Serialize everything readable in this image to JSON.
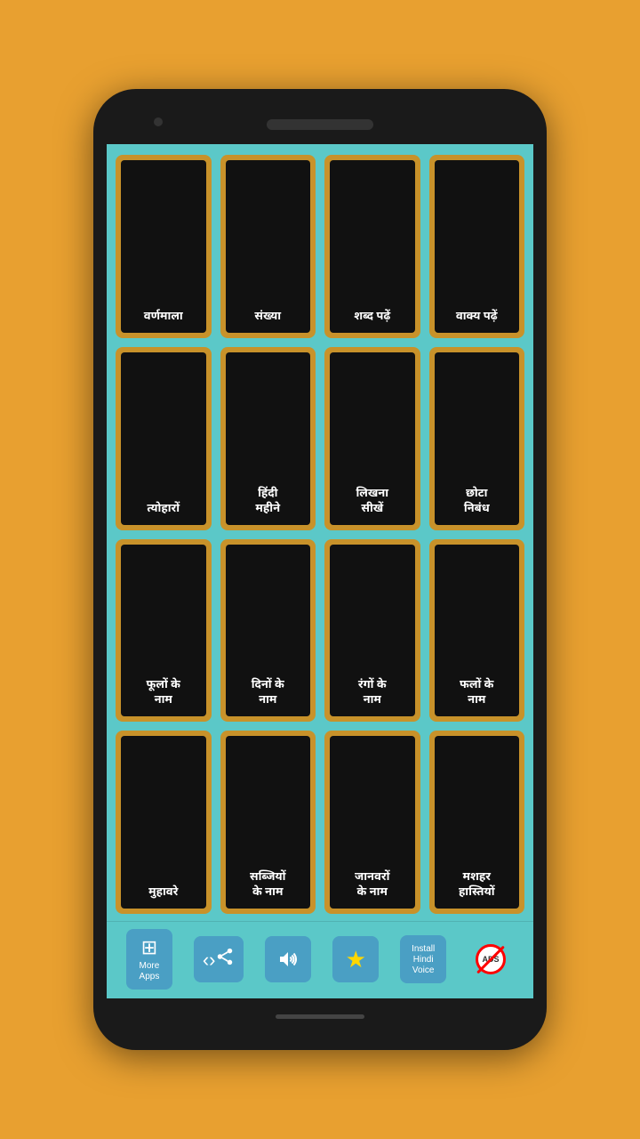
{
  "app": {
    "background_color": "#E8A030",
    "screen_color": "#5BC8C8"
  },
  "grid": {
    "rows": [
      [
        {
          "label": "वर्णमाला"
        },
        {
          "label": "संख्या"
        },
        {
          "label": "शब्द पढ़ें"
        },
        {
          "label": "वाक्य पढ़ें"
        }
      ],
      [
        {
          "label": "त्योहारों"
        },
        {
          "label": "हिंदी\nमहीने"
        },
        {
          "label": "लिखना\nसीखें"
        },
        {
          "label": "छोटा\nनिबंध"
        }
      ],
      [
        {
          "label": "फूलों के\nनाम"
        },
        {
          "label": "दिनों के\nनाम"
        },
        {
          "label": "रंगों के\nनाम"
        },
        {
          "label": "फलों के\nनाम"
        }
      ],
      [
        {
          "label": "मुहावरे"
        },
        {
          "label": "सब्जियों\nके नाम"
        },
        {
          "label": "जानवरों\nके नाम"
        },
        {
          "label": "मशहर\nहास्तियों"
        }
      ]
    ]
  },
  "bottom_bar": {
    "buttons": [
      {
        "id": "more-apps",
        "label": "More\nApps",
        "icon": "grid"
      },
      {
        "id": "share",
        "label": "",
        "icon": "share"
      },
      {
        "id": "sound",
        "label": "",
        "icon": "sound"
      },
      {
        "id": "rate",
        "label": "",
        "icon": "star"
      },
      {
        "id": "install-hindi",
        "label": "Install\nHindi\nVoice",
        "icon": "none"
      },
      {
        "id": "remove-ads",
        "label": "",
        "icon": "ads"
      }
    ]
  }
}
